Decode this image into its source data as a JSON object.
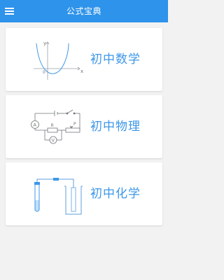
{
  "app": {
    "title": "公式宝典",
    "accent_color": "#2e93ea",
    "menu_icon": "hamburger-menu-icon"
  },
  "subjects": [
    {
      "label": "初中数学",
      "icon": "parabola-graph-icon"
    },
    {
      "label": "初中物理",
      "icon": "circuit-diagram-icon"
    },
    {
      "label": "初中化学",
      "icon": "lab-apparatus-icon"
    }
  ],
  "icon_text": {
    "math_axis_y": "y",
    "math_axis_x": "x",
    "math_origin": "0",
    "physics_ammeter": "A",
    "physics_voltmeter": "V",
    "physics_resistor": "R",
    "physics_slider": "P"
  }
}
